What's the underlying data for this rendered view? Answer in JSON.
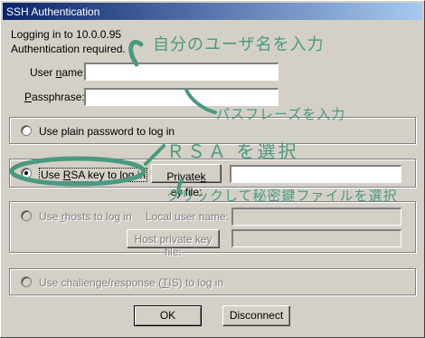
{
  "window": {
    "title": "SSH Authentication"
  },
  "info": {
    "line1": "Logging in to 10.0.0.95",
    "line2": "Authentication required."
  },
  "form": {
    "user_name_label": "User ",
    "user_name_label_u": "n",
    "user_name_label_rest": "ame:",
    "user_name_value": "",
    "passphrase_label_u": "P",
    "passphrase_label_rest": "assphrase:",
    "passphrase_value": ""
  },
  "options": {
    "plain_label": "Use plain password to log in",
    "rsa_label_pre": "Use ",
    "rsa_label_u": "R",
    "rsa_label_rest": "SA key to log in",
    "private_key_button_pre": "Private ",
    "private_key_button_u": "k",
    "private_key_button_rest": "ey file:",
    "private_key_value": "",
    "rhosts_label_pre": "Use ",
    "rhosts_label_u": "r",
    "rhosts_label_rest": "hosts to log in",
    "local_user_label": "Local user name:",
    "host_key_button": "Host private key file:",
    "challenge_label_pre": "Use challenge/response (",
    "challenge_label_u": "T",
    "challenge_label_rest": "IS) to log in"
  },
  "buttons": {
    "ok": "OK",
    "disconnect": "Disconnect"
  },
  "annotations": {
    "enter_username": "自分のユーザ名を入力",
    "enter_passphrase": "パスフレーズを入力",
    "select_rsa": "ＲＳＡ を選択",
    "click_select_key": "クリックして秘密鍵ファイルを選択"
  },
  "colors": {
    "annotation": "#4a9a7e",
    "title_start": "#0a246a",
    "title_end": "#a6caf0"
  }
}
